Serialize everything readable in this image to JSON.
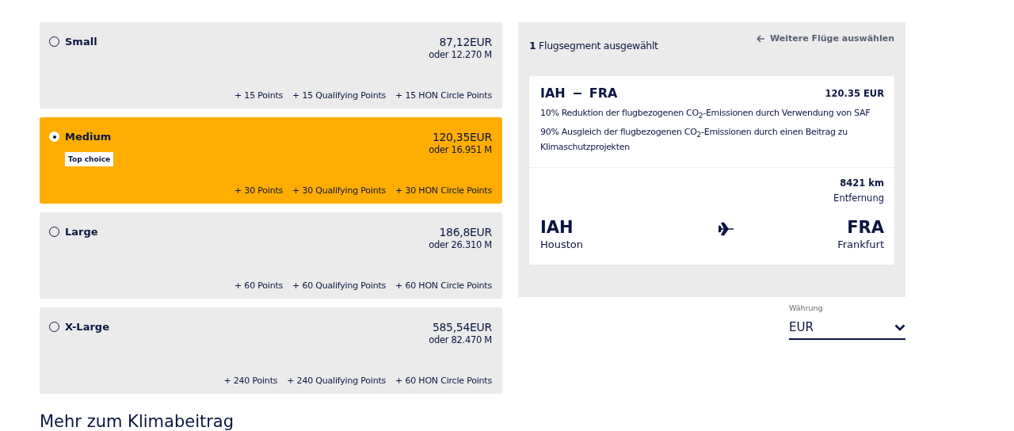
{
  "options": [
    {
      "name": "Small",
      "selected": false,
      "price": "87,12EUR",
      "miles": "oder 12.270 M",
      "points": [
        "+ 15 Points",
        "+ 15 Qualifying Points",
        "+ 15 HON Circle Points"
      ]
    },
    {
      "name": "Medium",
      "selected": true,
      "price": "120,35EUR",
      "miles": "oder 16.951 M",
      "badge": "Top choice",
      "points": [
        "+ 30 Points",
        "+ 30 Qualifying Points",
        "+ 30 HON Circle Points"
      ]
    },
    {
      "name": "Large",
      "selected": false,
      "price": "186,8EUR",
      "miles": "oder 26.310 M",
      "points": [
        "+ 60 Points",
        "+ 60 Qualifying Points",
        "+ 60 HON Circle Points"
      ]
    },
    {
      "name": "X-Large",
      "selected": false,
      "price": "585,54EUR",
      "miles": "oder 82.470 M",
      "points": [
        "+ 240 Points",
        "+ 240 Qualifying Points",
        "+ 60 HON Circle Points"
      ]
    }
  ],
  "more_link": "Mehr zum Klimabeitrag",
  "summary": {
    "segments": "**1** Flugsegment ausgewählt",
    "back_link": "Weitere Flüge auswählen",
    "flight": {
      "from": "IAH",
      "to": "FRA",
      "price": "120.35 EUR",
      "notes": [
        "10% Reduktion der flugbezogenen CO$_{2}$-Emissionen durch Verwendung von SAF",
        "90% Ausgleich der flugbezogenen CO$_{2}$-Emissionen durch einen Beitrag zu Klimaschutzprojekten"
      ],
      "distance": "8421 km",
      "from_code": "IAH",
      "to_code": "FRA",
      "distance_label": "Entfernung",
      "from_city": "Houston",
      "to_city": "Frankfurt"
    }
  },
  "currency": {
    "label": "Währung",
    "value": "EUR"
  }
}
